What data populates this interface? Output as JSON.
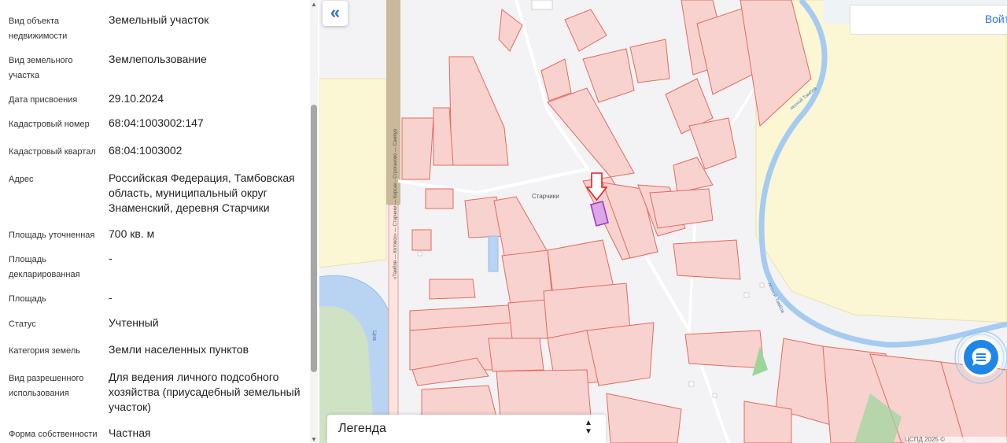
{
  "properties": [
    {
      "label": "Вид объекта недвижимости",
      "value": "Земельный участок"
    },
    {
      "label": "Вид земельного участка",
      "value": "Землепользование"
    },
    {
      "label": "Дата присвоения",
      "value": "29.10.2024"
    },
    {
      "label": "Кадастровый номер",
      "value": "68:04:1003002:147"
    },
    {
      "label": "Кадастровый квартал",
      "value": "68:04:1003002"
    },
    {
      "label": "Адрес",
      "value": "Российская Федерация, Тамбовская область, муниципальный округ Знаменский, деревня Старчики"
    },
    {
      "label": "Площадь уточненная",
      "value": "700 кв. м"
    },
    {
      "label": "Площадь декларированная",
      "value": "-"
    },
    {
      "label": "Площадь",
      "value": "-"
    },
    {
      "label": "Статус",
      "value": "Учтенный"
    },
    {
      "label": "Категория земель",
      "value": "Земли населенных пунктов"
    },
    {
      "label": "Вид разрешенного использования",
      "value": "Для ведения личного подсобного хозяйства (приусадебный земельный участок)"
    },
    {
      "label": "Форма собственности",
      "value": "Частная"
    }
  ],
  "map": {
    "collapse_icon": "«",
    "login_label": "Войти",
    "legend_title": "Легенда",
    "village_label": "Старчики",
    "road_label": "«Тамбов — Котовск» — Старчики — Кирсан - Строганово — Сампур",
    "river_label": "лесной Тамбов",
    "river_label_2": "лесной Тамбов",
    "lake_label": "Цна",
    "attribution": "ЦСПД 2025 ©",
    "colors": {
      "parcel_fill": "#f8d2cf",
      "parcel_stroke": "#e46a5e",
      "selected_fill": "#d9a6e6",
      "selected_stroke": "#a42fc7",
      "marker": "#e02020",
      "accent": "#2b6fd6"
    }
  }
}
